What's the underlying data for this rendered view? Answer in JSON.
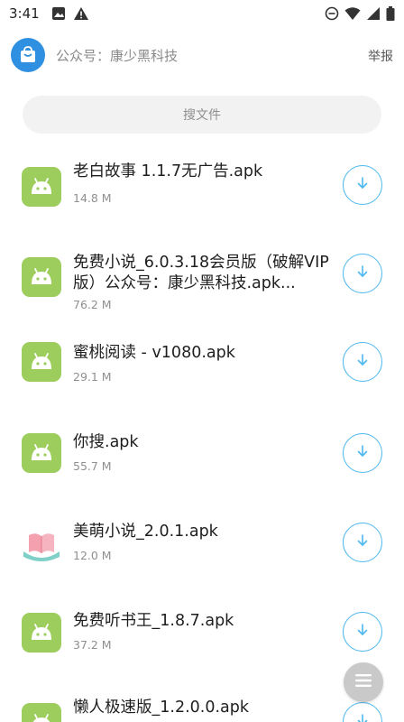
{
  "status_bar": {
    "time": "3:41",
    "left_icons": [
      "image-icon",
      "warning-icon"
    ],
    "right_icons": [
      "do-not-disturb-icon",
      "wifi-icon",
      "signal-icon",
      "battery-icon"
    ]
  },
  "header": {
    "title": "公众号：康少黑科技",
    "report_label": "举报",
    "icon": "bag-icon"
  },
  "search": {
    "placeholder": "搜文件"
  },
  "files": [
    {
      "name": "老白故事 1.1.7无广告.apk",
      "size": "14.8 M",
      "icon": "android-icon"
    },
    {
      "name": "免费小说_6.0.3.18会员版（破解VIP版）公众号：康少黑科技.apk...",
      "size": "76.2 M",
      "icon": "android-icon"
    },
    {
      "name": "蜜桃阅读 - v1080.apk",
      "size": "29.1 M",
      "icon": "android-icon"
    },
    {
      "name": "你搜.apk",
      "size": "55.7 M",
      "icon": "android-icon"
    },
    {
      "name": "美萌小说_2.0.1.apk",
      "size": "12.0 M",
      "icon": "book-icon"
    },
    {
      "name": "免费听书王_1.8.7.apk",
      "size": "37.2 M",
      "icon": "android-icon"
    },
    {
      "name": "懒人极速版_1.2.0.0.apk",
      "size": "",
      "icon": "android-icon"
    }
  ],
  "colors": {
    "accent": "#4db8ee",
    "android_icon_bg": "#9ccd5d",
    "app_icon_bg": "#2f8fe0",
    "fab_bg": "#c9c9c9"
  }
}
